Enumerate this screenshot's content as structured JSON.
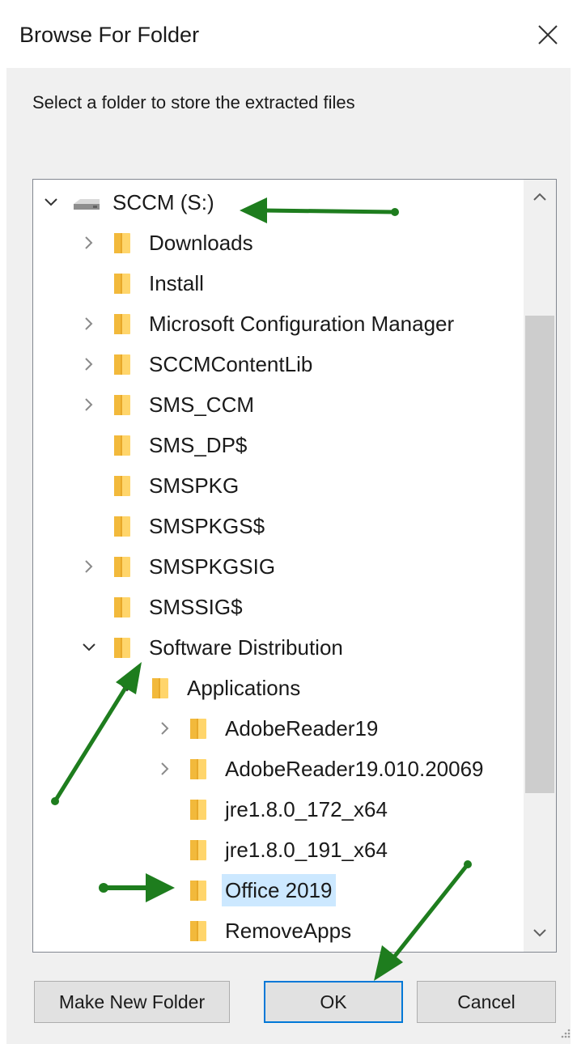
{
  "dialog": {
    "title": "Browse For Folder",
    "instruction": "Select a folder to store the extracted files"
  },
  "tree": {
    "items": [
      {
        "label": "SCCM (S:)",
        "icon": "drive-icon",
        "expander": "expanded"
      },
      {
        "label": "Downloads",
        "icon": "folder-icon",
        "expander": "collapsed"
      },
      {
        "label": "Install",
        "icon": "folder-icon",
        "expander": "none"
      },
      {
        "label": "Microsoft Configuration Manager",
        "icon": "folder-icon",
        "expander": "collapsed"
      },
      {
        "label": "SCCMContentLib",
        "icon": "folder-icon",
        "expander": "collapsed"
      },
      {
        "label": "SMS_CCM",
        "icon": "folder-icon",
        "expander": "collapsed"
      },
      {
        "label": "SMS_DP$",
        "icon": "folder-icon",
        "expander": "none"
      },
      {
        "label": "SMSPKG",
        "icon": "folder-icon",
        "expander": "none"
      },
      {
        "label": "SMSPKGS$",
        "icon": "folder-icon",
        "expander": "none"
      },
      {
        "label": "SMSPKGSIG",
        "icon": "folder-icon",
        "expander": "collapsed"
      },
      {
        "label": "SMSSIG$",
        "icon": "folder-icon",
        "expander": "none"
      },
      {
        "label": "Software Distribution",
        "icon": "folder-icon",
        "expander": "expanded"
      },
      {
        "label": "Applications",
        "icon": "folder-icon",
        "expander": "expanded"
      },
      {
        "label": "AdobeReader19",
        "icon": "folder-icon",
        "expander": "collapsed"
      },
      {
        "label": "AdobeReader19.010.20069",
        "icon": "folder-icon",
        "expander": "collapsed"
      },
      {
        "label": "jre1.8.0_172_x64",
        "icon": "folder-icon",
        "expander": "none"
      },
      {
        "label": "jre1.8.0_191_x64",
        "icon": "folder-icon",
        "expander": "none"
      },
      {
        "label": "Office 2019",
        "icon": "folder-icon",
        "expander": "none",
        "selected": true
      },
      {
        "label": "RemoveApps",
        "icon": "folder-icon",
        "expander": "none"
      }
    ]
  },
  "buttons": {
    "make_new_folder": "Make New Folder",
    "ok": "OK",
    "cancel": "Cancel"
  },
  "colors": {
    "selection": "#cce8ff",
    "folder": "#ffd56b",
    "annotation_arrow": "#1e7d1e",
    "default_button_border": "#0078d7"
  }
}
